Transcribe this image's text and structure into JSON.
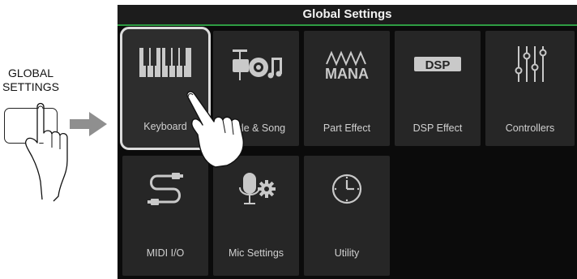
{
  "hardware": {
    "button_label_line1": "GLOBAL",
    "button_label_line2": "SETTINGS"
  },
  "screen": {
    "title": "Global Settings",
    "tiles": [
      {
        "label": "Keyboard",
        "icon": "keyboard-icon",
        "selected": true
      },
      {
        "label": "Style & Song",
        "icon": "drum-kit-icon",
        "selected": false
      },
      {
        "label": "Part Effect",
        "icon": "mana-logo-icon",
        "selected": false
      },
      {
        "label": "DSP Effect",
        "icon": "dsp-icon",
        "selected": false
      },
      {
        "label": "Controllers",
        "icon": "sliders-icon",
        "selected": false
      },
      {
        "label": "MIDI I/O",
        "icon": "cable-icon",
        "selected": false
      },
      {
        "label": "Mic Settings",
        "icon": "mic-gear-icon",
        "selected": false
      },
      {
        "label": "Utility",
        "icon": "clock-icon",
        "selected": false
      }
    ],
    "mana_text": "MANA",
    "dsp_text": "DSP"
  },
  "colors": {
    "accent": "#2e9c43",
    "tile_bg": "#262626",
    "screen_bg": "#0b0b0b",
    "icon": "#c9c9c9"
  }
}
